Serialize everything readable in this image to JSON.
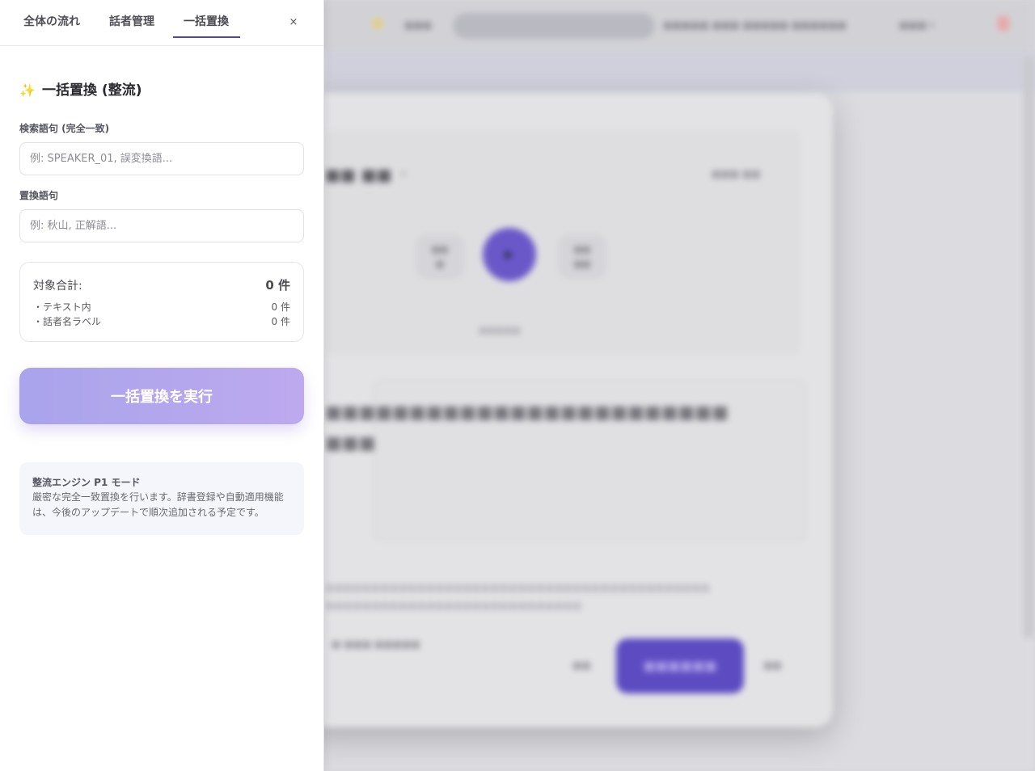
{
  "tabs": [
    {
      "label": "全体の流れ"
    },
    {
      "label": "話者管理"
    },
    {
      "label": "一括置換"
    }
  ],
  "close_label": "×",
  "section": {
    "icon": "sparkles-icon",
    "title": "一括置換 (整流)"
  },
  "search": {
    "label": "検索語句 (完全一致)",
    "value": "",
    "placeholder": "例: SPEAKER_01, 誤変換語..."
  },
  "replace": {
    "label": "置換語句",
    "value": "",
    "placeholder": "例: 秋山, 正解語..."
  },
  "counts": {
    "total_label": "対象合計:",
    "total_value": "0 件",
    "rows": [
      {
        "label": "・テキスト内",
        "value": "0 件"
      },
      {
        "label": "・話者名ラベル",
        "value": "0 件"
      }
    ]
  },
  "execute_label": "一括置換を実行",
  "info": {
    "title": "整流エンジン P1 モード",
    "text": "厳密な完全一致置換を行います。辞書登録や自動適用機能は、今後のアップデートで順次追加される予定です。"
  },
  "colors": {
    "accent": "#4d3fc0",
    "button_gradient_start": "#a9a4ec",
    "button_gradient_end": "#bda9ee"
  }
}
